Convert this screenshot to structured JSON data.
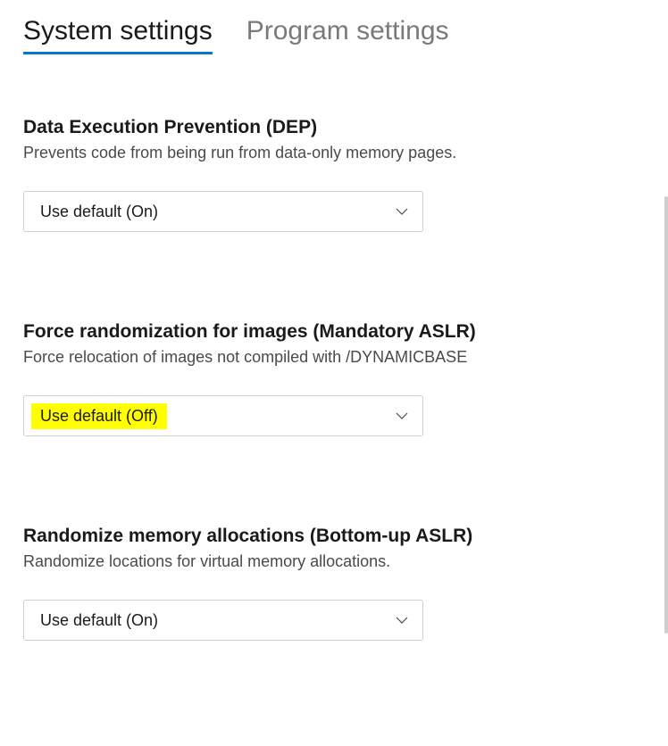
{
  "tabs": {
    "system": "System settings",
    "program": "Program settings"
  },
  "settings": [
    {
      "title": "Data Execution Prevention (DEP)",
      "description": "Prevents code from being run from data-only memory pages.",
      "value": "Use default (On)",
      "highlighted": false
    },
    {
      "title": "Force randomization for images (Mandatory ASLR)",
      "description": "Force relocation of images not compiled with /DYNAMICBASE",
      "value": "Use default (Off)",
      "highlighted": true
    },
    {
      "title": "Randomize memory allocations (Bottom-up ASLR)",
      "description": "Randomize locations for virtual memory allocations.",
      "value": "Use default (On)",
      "highlighted": false
    }
  ]
}
